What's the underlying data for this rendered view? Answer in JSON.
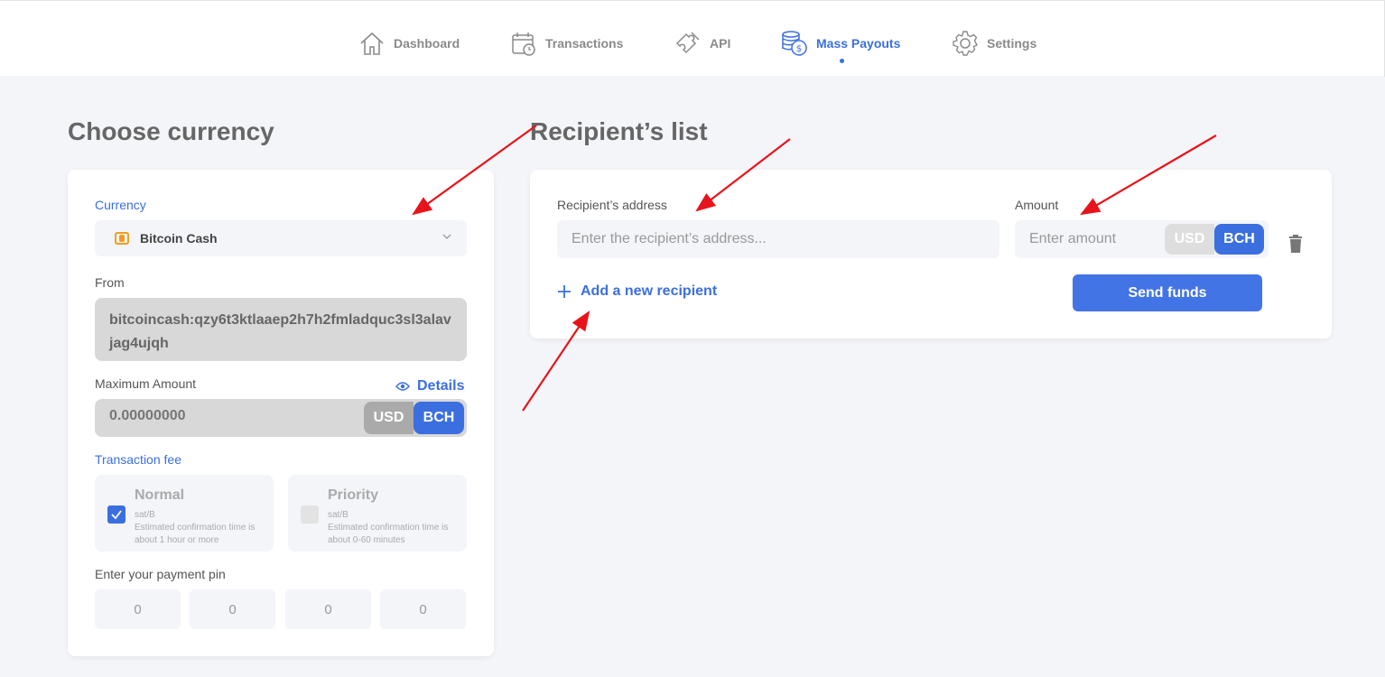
{
  "nav": {
    "items": [
      {
        "label": "Dashboard",
        "icon": "home-icon",
        "active": false
      },
      {
        "label": "Transactions",
        "icon": "calendar-clock-icon",
        "active": false
      },
      {
        "label": "API",
        "icon": "puzzle-icon",
        "active": false
      },
      {
        "label": "Mass Payouts",
        "icon": "coins-icon",
        "active": true
      },
      {
        "label": "Settings",
        "icon": "gear-icon",
        "active": false
      }
    ],
    "accent": "#3b6fe0"
  },
  "left": {
    "heading": "Choose currency",
    "currency_label": "Currency",
    "currency_value": "Bitcoin Cash",
    "from_label": "From",
    "from_value": "bitcoincash:qzy6t3ktlaaep2h7h2fmladquc3sl3alavjag4ujqh",
    "max_label": "Maximum Amount",
    "details_label": "Details",
    "max_value": "0.00000000",
    "unit_usd": "USD",
    "unit_bch": "BCH",
    "fee_label": "Transaction fee",
    "fees": [
      {
        "title": "Normal",
        "unit": "sat/B",
        "desc": "Estimated confirmation time is about 1 hour or more",
        "checked": true
      },
      {
        "title": "Priority",
        "unit": "sat/B",
        "desc": "Estimated confirmation time is about 0-60 minutes",
        "checked": false
      }
    ],
    "pin_label": "Enter your payment pin",
    "pin": [
      "0",
      "0",
      "0",
      "0"
    ]
  },
  "right": {
    "heading": "Recipient’s list",
    "address_label": "Recipient’s address",
    "address_placeholder": "Enter the recipient’s address...",
    "amount_label": "Amount",
    "amount_placeholder": "Enter amount",
    "unit_usd": "USD",
    "unit_bch": "BCH",
    "add_label": "Add a new recipient",
    "send_label": "Send funds"
  },
  "colors": {
    "primary": "#4374e6",
    "annotation_arrow": "#e8141b",
    "coin": "#f29d1e"
  }
}
